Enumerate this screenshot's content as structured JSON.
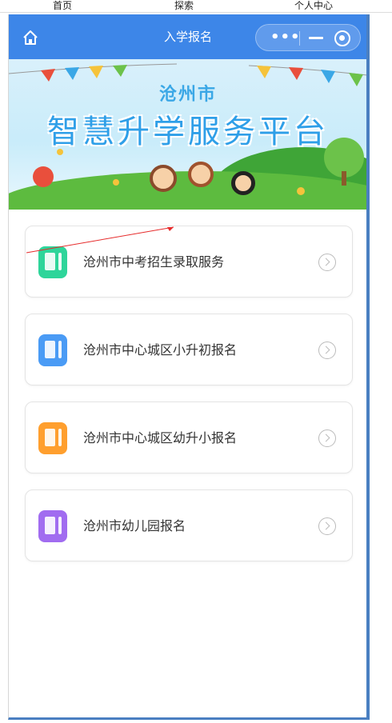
{
  "top_nav": {
    "home": "首页",
    "explore": "探索",
    "profile": "个人中心"
  },
  "app": {
    "title": "入学报名",
    "capsule_dots": "•••"
  },
  "banner": {
    "city": "沧州市",
    "slogan": "智慧升学服务平台"
  },
  "services": [
    {
      "label": "沧州市中考招生录取服务",
      "icon": "high-school-icon",
      "color": "#2ed59a"
    },
    {
      "label": "沧州市中心城区小升初报名",
      "icon": "middle-school-icon",
      "color": "#4a9bf5"
    },
    {
      "label": "沧州市中心城区幼升小报名",
      "icon": "primary-school-icon",
      "color": "#ff9f2e"
    },
    {
      "label": "沧州市幼儿园报名",
      "icon": "kindergarten-icon",
      "color": "#a16cf0"
    }
  ]
}
